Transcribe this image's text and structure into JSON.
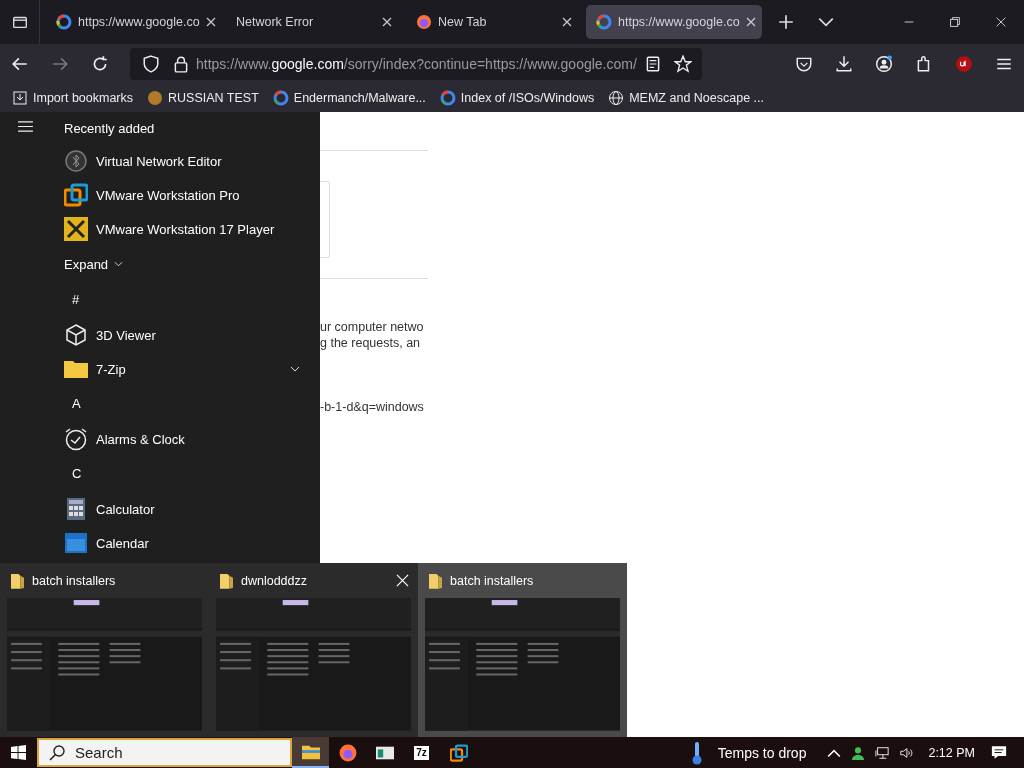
{
  "tabs": [
    {
      "title": "https://www.google.co",
      "kind": "google",
      "selected": false
    },
    {
      "title": "Network Error",
      "kind": "plain",
      "selected": false
    },
    {
      "title": "New Tab",
      "kind": "firefox",
      "selected": false
    },
    {
      "title": "https://www.google.co",
      "kind": "google",
      "selected": true
    }
  ],
  "address": {
    "prefix": "https://www.",
    "domain": "google.com",
    "rest": "/sorry/index?continue=https://www.google.com/"
  },
  "bookmarks": [
    {
      "label": "Import bookmarks",
      "kind": "import"
    },
    {
      "label": "RUSSIAN TEST",
      "kind": "round"
    },
    {
      "label": "Endermanch/Malware...",
      "kind": "google"
    },
    {
      "label": "Index of /ISOs/Windows",
      "kind": "google"
    },
    {
      "label": "MEMZ and Noescape ...",
      "kind": "globe"
    }
  ],
  "start_menu": {
    "header": "Recently added",
    "items": [
      {
        "kind": "network",
        "label": "Virtual Network Editor"
      },
      {
        "kind": "workstation",
        "label": "VMware Workstation Pro"
      },
      {
        "kind": "player",
        "label": "VMware Workstation 17 Player"
      },
      {
        "kind": "expand",
        "label": "Expand"
      },
      {
        "kind": "letter",
        "label": "#"
      },
      {
        "kind": "cube",
        "label": "3D Viewer"
      },
      {
        "kind": "folder",
        "label": "7-Zip"
      },
      {
        "kind": "letter",
        "label": "A"
      },
      {
        "kind": "clock",
        "label": "Alarms & Clock"
      },
      {
        "kind": "letter",
        "label": "C"
      },
      {
        "kind": "calculator",
        "label": "Calculator"
      },
      {
        "kind": "calendar",
        "label": "Calendar"
      }
    ]
  },
  "page": {
    "lines": [
      "ur computer netwo",
      "g the requests, an",
      "-b-1-d&q=windows"
    ]
  },
  "thumbnails": [
    {
      "title": "batch installers",
      "highlighted": false,
      "close": false
    },
    {
      "title": "dwnlodddzz",
      "highlighted": false,
      "close": true
    },
    {
      "title": "batch installers",
      "highlighted": true,
      "close": false
    }
  ],
  "taskbar": {
    "search_placeholder": "Search",
    "apps": [
      {
        "kind": "explorer",
        "selected": true
      },
      {
        "kind": "firefox",
        "selected": false
      },
      {
        "kind": "app",
        "selected": false
      },
      {
        "kind": "archiver",
        "label": "7z",
        "selected": false
      },
      {
        "kind": "workstation",
        "selected": false
      }
    ],
    "weather": "Temps to drop",
    "time": "2:12 PM"
  }
}
